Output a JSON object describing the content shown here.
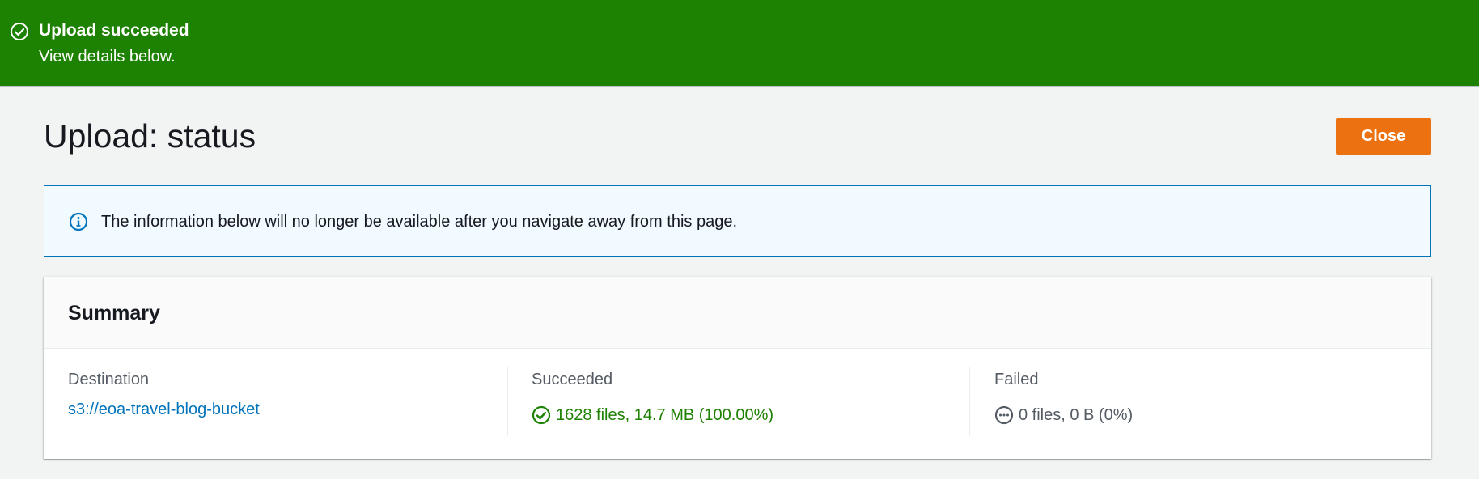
{
  "flash": {
    "title": "Upload succeeded",
    "message": "View details below.",
    "icon": "check-circle-icon",
    "color": "#1d8102"
  },
  "page": {
    "title": "Upload: status",
    "close_label": "Close",
    "accent_color": "#ec7211"
  },
  "info": {
    "icon": "info-circle-icon",
    "text": "The information below will no longer be available after you navigate away from this page."
  },
  "summary": {
    "title": "Summary",
    "destination": {
      "label": "Destination",
      "value": "s3://eoa-travel-blog-bucket"
    },
    "succeeded": {
      "label": "Succeeded",
      "value": "1628 files, 14.7 MB (100.00%)",
      "icon": "check-circle-icon"
    },
    "failed": {
      "label": "Failed",
      "value": "0 files, 0 B (0%)",
      "icon": "ellipsis-circle-icon"
    }
  }
}
